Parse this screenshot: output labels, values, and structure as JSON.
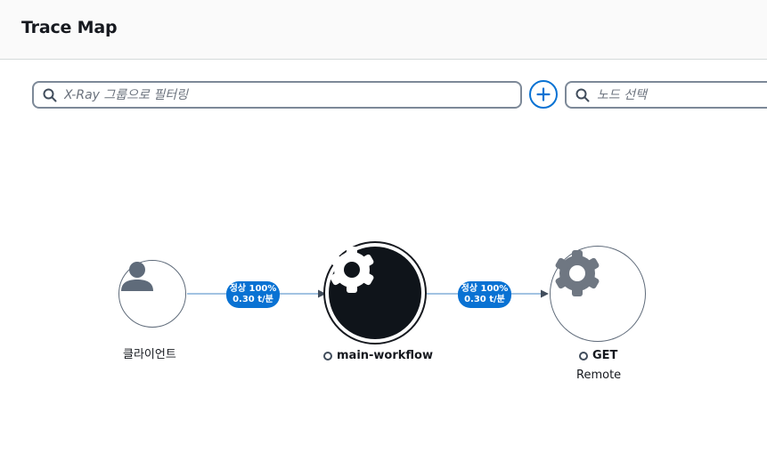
{
  "header": {
    "title": "Trace Map"
  },
  "filters": {
    "group_placeholder": "X-Ray 그룹으로 필터링",
    "node_placeholder": "노드 선택"
  },
  "nodes": {
    "client": {
      "label": "클라이언트"
    },
    "main": {
      "label": "main-workflow"
    },
    "remote": {
      "label": "GET",
      "sublabel": "Remote"
    }
  },
  "edges": [
    {
      "status": "정상 100%",
      "rate": "0.30 t/분"
    },
    {
      "status": "정상 100%",
      "rate": "0.30 t/분"
    }
  ],
  "colors": {
    "accent": "#0972d3",
    "node_dark": "#0f141a",
    "icon_gray": "#5f6b7a"
  },
  "icons": {
    "search": "search-icon",
    "add": "plus-icon",
    "client": "user-icon",
    "service": "gear-icon"
  }
}
